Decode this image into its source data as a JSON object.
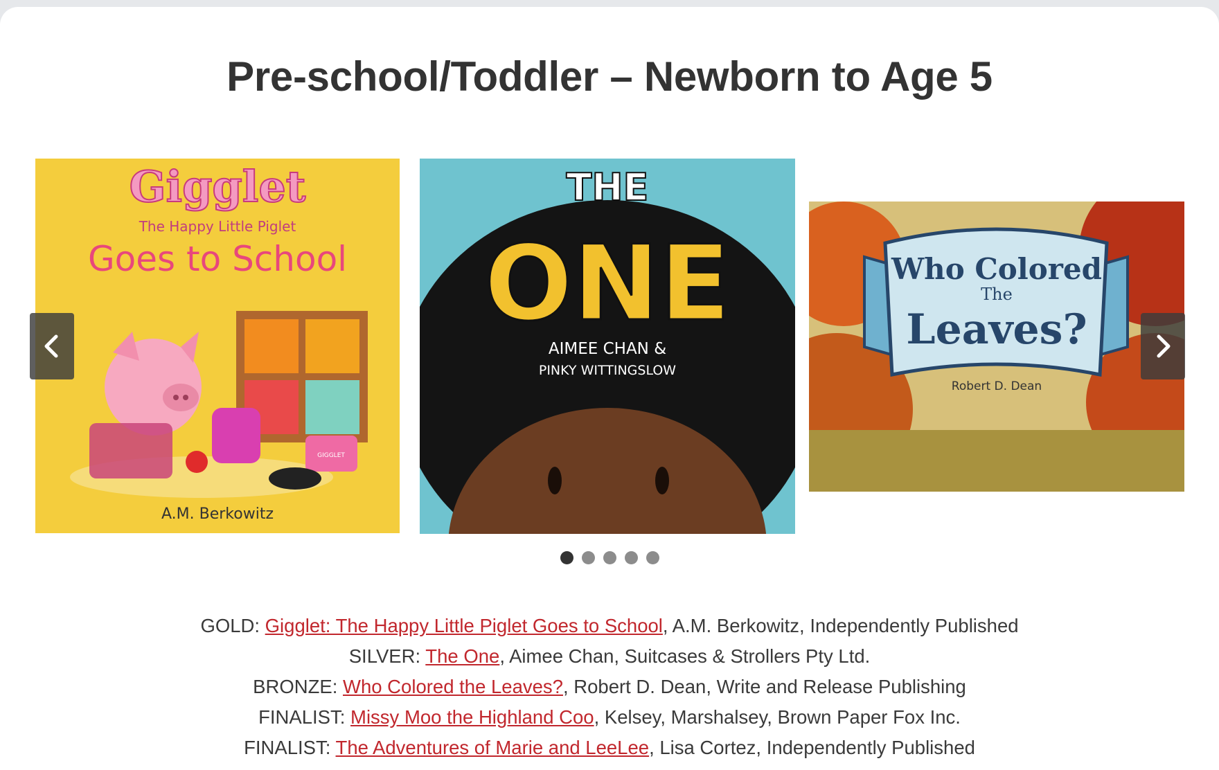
{
  "heading": "Pre-school/Toddler – Newborn to Age 5",
  "covers": [
    {
      "title_line1": "Gigglet",
      "title_line2": "The Happy Little Piglet",
      "title_line3": "Goes to School",
      "author": "A.M. Berkowitz",
      "bag_label": "GIGGLET",
      "bg": "#f4cd3d",
      "accent": "#e8477c"
    },
    {
      "title_line1": "THE",
      "title_line2": "ONE",
      "author_line1": "AIMEE CHAN &",
      "author_line2": "PINKY WITTINGSLOW",
      "bg": "#6fc3cf",
      "accent": "#f2c12e"
    },
    {
      "title_line1": "Who Colored",
      "title_line2": "The",
      "title_line3": "Leaves?",
      "author": "Robert D. Dean",
      "bg": "#b88a4a",
      "accent": "#cfe6ef"
    }
  ],
  "carousel": {
    "prev_icon": "chevron-left-icon",
    "next_icon": "chevron-right-icon",
    "dots_count": 5,
    "active_dot": 0
  },
  "winners": [
    {
      "award": "GOLD: ",
      "title": "Gigglet: The Happy Little Piglet Goes to School",
      "rest": ", A.M. Berkowitz, Independently Published"
    },
    {
      "award": "SILVER: ",
      "title": "The One",
      "rest": ", Aimee Chan, Suitcases & Strollers Pty Ltd."
    },
    {
      "award": "BRONZE: ",
      "title": "Who Colored the Leaves?",
      "rest": ", Robert D. Dean, Write and Release Publishing"
    },
    {
      "award": "FINALIST: ",
      "title": "Missy Moo the Highland Coo",
      "rest": ", Kelsey, Marshalsey, Brown Paper Fox Inc."
    },
    {
      "award": "FINALIST: ",
      "title": "The Adventures of Marie and LeeLee",
      "rest": ", Lisa Cortez, Independently Published"
    }
  ],
  "colors": {
    "link": "#c1272d",
    "text": "#3a3a3a",
    "heading": "#333333"
  }
}
